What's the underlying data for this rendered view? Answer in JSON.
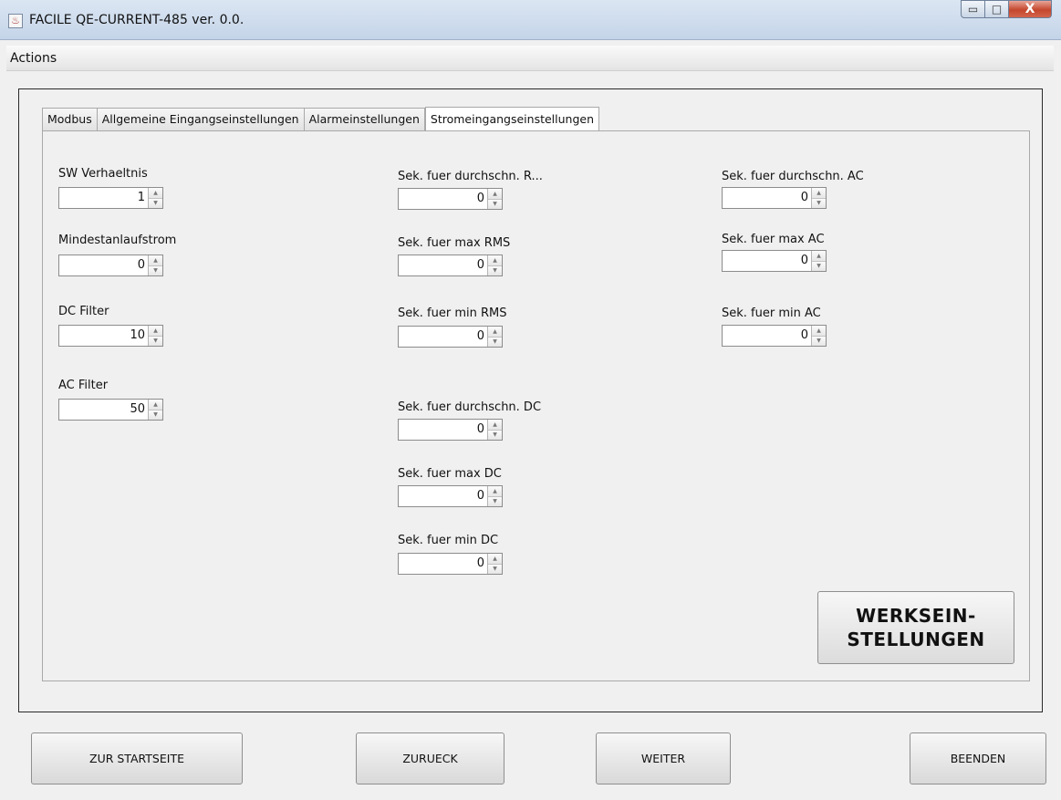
{
  "window": {
    "title": "FACILE QE-CURRENT-485 ver. 0.0.",
    "minimize_glyph": "▭",
    "maximize_glyph": "□",
    "close_glyph": "X",
    "app_icon_glyph": "♨"
  },
  "menu": {
    "actions_label": "Actions"
  },
  "tabs": [
    {
      "label": "Modbus",
      "active": false
    },
    {
      "label": "Allgemeine Eingangseinstellungen",
      "active": false
    },
    {
      "label": "Alarmeinstellungen",
      "active": false
    },
    {
      "label": "Stromeingangseinstellungen",
      "active": true
    }
  ],
  "fields": {
    "sw_verhaeltnis": {
      "label": "SW Verhaeltnis",
      "value": "1"
    },
    "mindestanlaufstrom": {
      "label": "Mindestanlaufstrom",
      "value": "0"
    },
    "dc_filter": {
      "label": "DC Filter",
      "value": "10"
    },
    "ac_filter": {
      "label": "AC Filter",
      "value": "50"
    },
    "sek_durchschn_r": {
      "label": "Sek. fuer durchschn. R...",
      "value": "0"
    },
    "sek_max_rms": {
      "label": "Sek. fuer max RMS",
      "value": "0"
    },
    "sek_min_rms": {
      "label": "Sek. fuer min RMS",
      "value": "0"
    },
    "sek_durchschn_dc": {
      "label": "Sek. fuer durchschn. DC",
      "value": "0"
    },
    "sek_max_dc": {
      "label": "Sek. fuer max DC",
      "value": "0"
    },
    "sek_min_dc": {
      "label": "Sek. fuer min DC",
      "value": "0"
    },
    "sek_durchschn_ac": {
      "label": "Sek. fuer durchschn. AC",
      "value": "0"
    },
    "sek_max_ac": {
      "label": "Sek. fuer max AC",
      "value": "0"
    },
    "sek_min_ac": {
      "label": "Sek. fuer min AC",
      "value": "0"
    }
  },
  "spinner_arrows": {
    "up": "▲",
    "down": "▼"
  },
  "factory_button": {
    "line1": "WERKSEIN-",
    "line2": "STELLUNGEN"
  },
  "nav": {
    "start_label": "ZUR STARTSEITE",
    "back_label": "ZURUECK",
    "next_label": "WEITER",
    "exit_label": "BEENDEN"
  }
}
